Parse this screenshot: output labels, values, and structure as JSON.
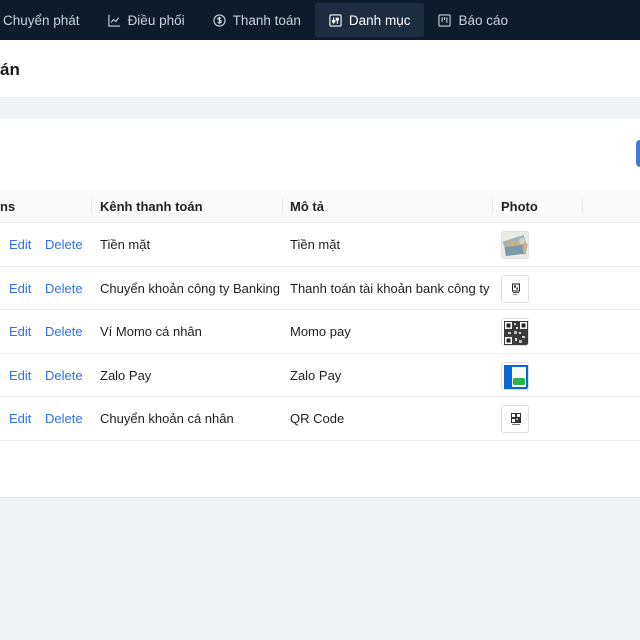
{
  "nav": {
    "items": [
      {
        "label": "Chuyển phát",
        "icon": "none"
      },
      {
        "label": "Điều phối",
        "icon": "line-chart-icon"
      },
      {
        "label": "Thanh toán",
        "icon": "dollar-circle-icon"
      },
      {
        "label": "Danh mục",
        "icon": "sliders-icon",
        "active": true
      },
      {
        "label": "Báo cáo",
        "icon": "board-icon"
      }
    ]
  },
  "page": {
    "title": "án"
  },
  "table": {
    "columns": [
      "ns",
      "Kênh thanh toán",
      "Mô tả",
      "Photo"
    ],
    "rows": [
      {
        "edit": "Edit",
        "delete": "Delete",
        "channel": "Tiền mặt",
        "description": "Tiền mặt",
        "photo": "cash-photo"
      },
      {
        "edit": "Edit",
        "delete": "Delete",
        "channel": "Chuyển khoản công ty Banking",
        "description": "Thanh toán tài khoản bank công ty",
        "photo": "qr-small-photo"
      },
      {
        "edit": "Edit",
        "delete": "Delete",
        "channel": "Ví Momo cá nhân",
        "description": "Momo pay",
        "photo": "qr-photo"
      },
      {
        "edit": "Edit",
        "delete": "Delete",
        "channel": "Zalo Pay",
        "description": "Zalo Pay",
        "photo": "zalopay-logo"
      },
      {
        "edit": "Edit",
        "delete": "Delete",
        "channel": "Chuyển khoản cá nhân",
        "description": "QR Code",
        "photo": "qr-small-photo"
      }
    ]
  },
  "colors": {
    "nav_bg": "#0d1b2a",
    "link": "#2f72e4",
    "primary_button": "#3b7ddd"
  }
}
